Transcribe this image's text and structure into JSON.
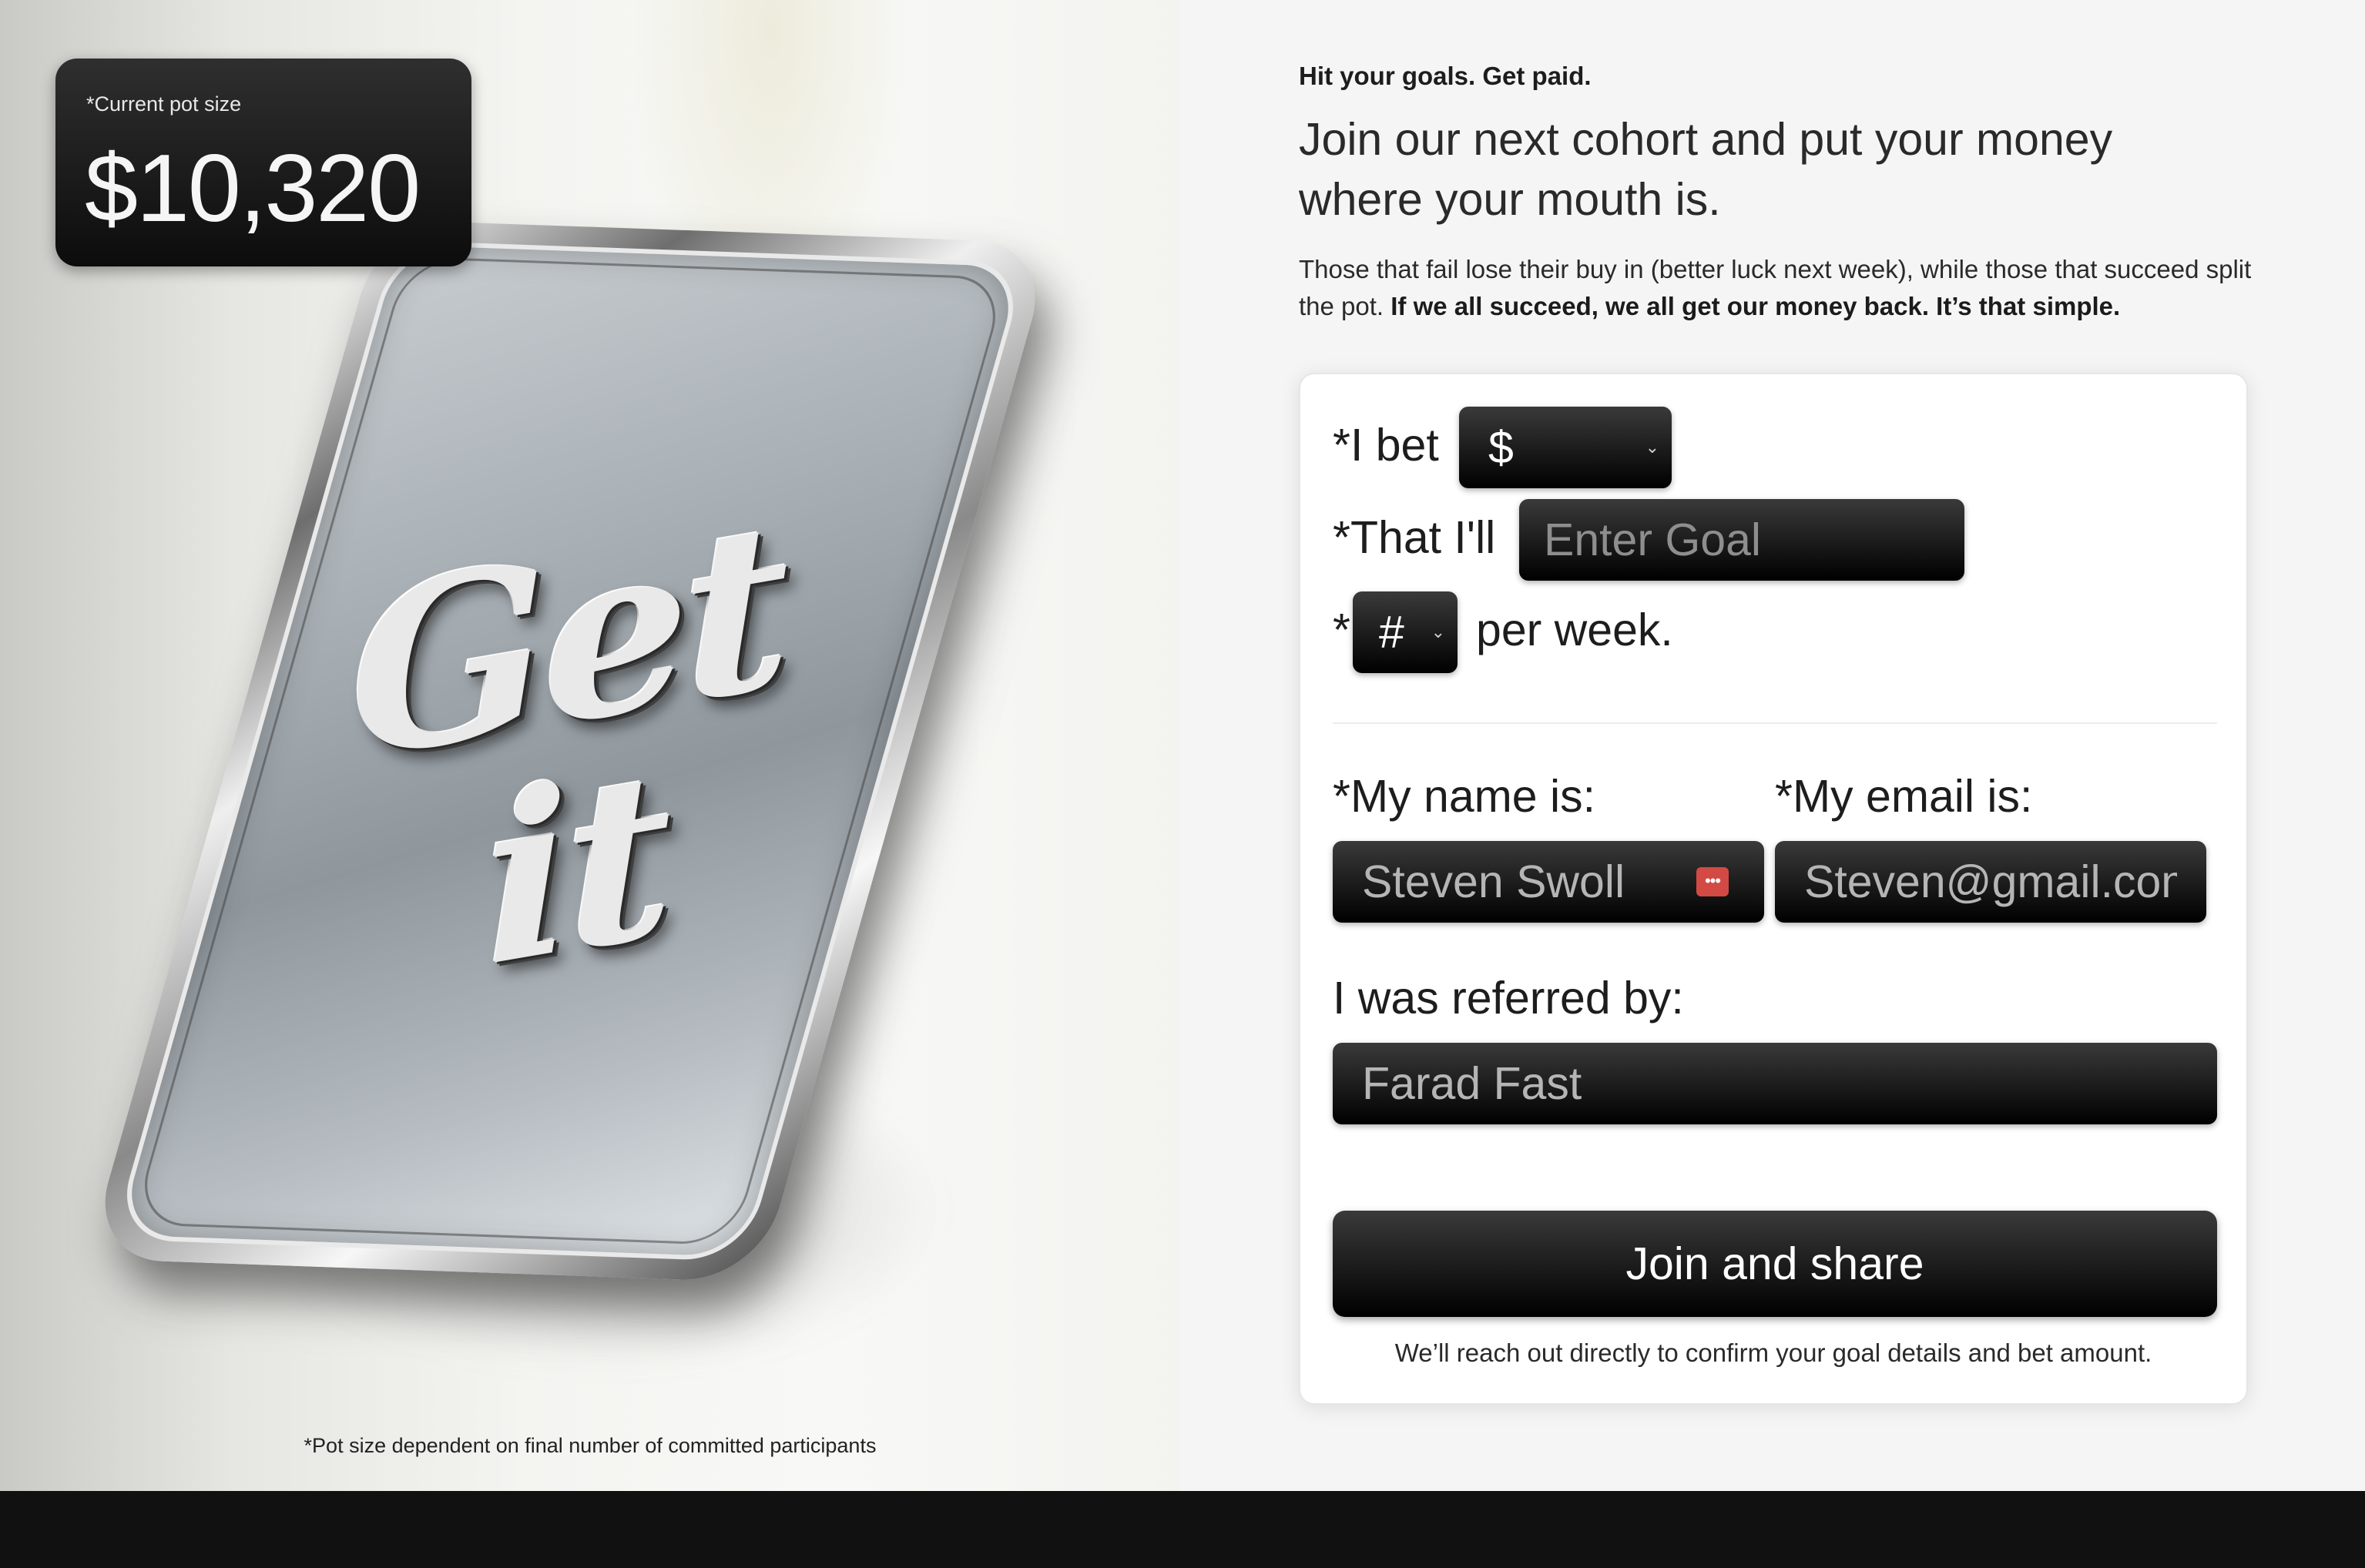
{
  "hero": {
    "pot_label": "*Current pot size",
    "pot_value": "$10,320",
    "image_text": "Get it",
    "footnote": "*Pot size dependent on final number of committed participants"
  },
  "intro": {
    "eyebrow": "Hit your goals. Get paid.",
    "headline": "Join our next cohort and put your money where your mouth is.",
    "body": "Those that fail lose their buy in (better luck next week), while those that succeed split the pot.",
    "body_bold": "If we all succeed, we all get our money back. It’s that simple."
  },
  "form": {
    "bet_label": "*I bet",
    "bet_select": "$",
    "goal_label": "*That I'll",
    "goal_placeholder": "Enter Goal",
    "freq_prefix": "*",
    "freq_select": "#",
    "freq_suffix": "per week.",
    "name_label": "*My name is:",
    "name_value": "Steven Swoll",
    "email_label": "*My email is:",
    "email_value": "Steven@gmail.com",
    "referral_label": "I was referred by:",
    "referral_value": "Farad Fast",
    "submit_label": "Join and share",
    "note": "We’ll reach out directly to confirm your goal details and bet amount."
  },
  "icons": {
    "select_chevron": "chevron-down-icon",
    "password_manager": "password-manager-icon"
  },
  "colors": {
    "page_bg": "#f5f5f5",
    "card_bg": "#ffffff",
    "control_bg": "#000000",
    "placeholder_text": "#8e8e8e",
    "password_icon": "#d24a43",
    "footer_bg": "#111111"
  }
}
